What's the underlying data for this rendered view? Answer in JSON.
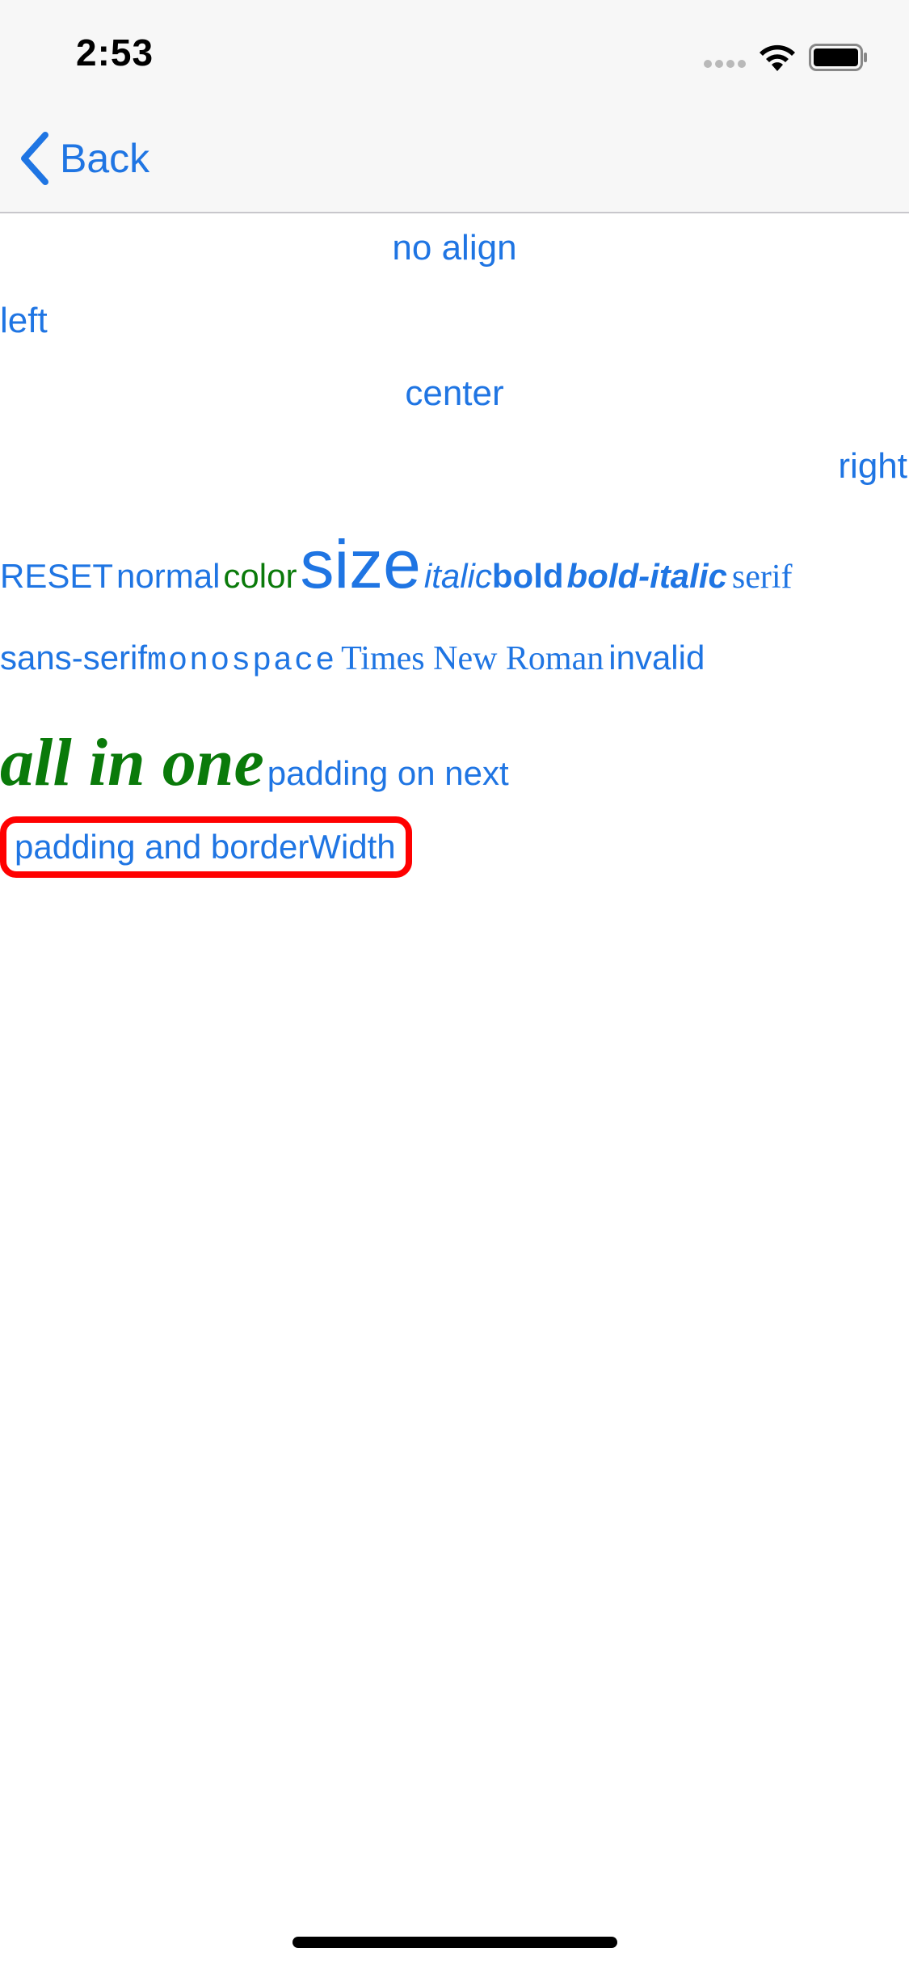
{
  "status_bar": {
    "time": "2:53"
  },
  "nav": {
    "back_label": "Back",
    "accent_color": "#1f75e3"
  },
  "rows": {
    "no_align": "no align",
    "left": "left",
    "center": "center",
    "right": "right"
  },
  "style_row": {
    "reset": "RESET",
    "normal": "normal",
    "color": "color",
    "size": "size",
    "italic": "italic",
    "bold": "bold",
    "bold_italic": "bold-italic",
    "serif": "serif"
  },
  "font_row": {
    "sans_serif": "sans-serif",
    "monospace": "monospace",
    "times": "Times New Roman",
    "invalid": "invalid"
  },
  "combo_row": {
    "all_in_one": "all in one",
    "padding_next": "padding on next"
  },
  "bordered_text": "padding and borderWidth",
  "colors": {
    "text_blue": "#1f75e3",
    "green": "#0a7a0a",
    "border_red": "#ff0000"
  }
}
